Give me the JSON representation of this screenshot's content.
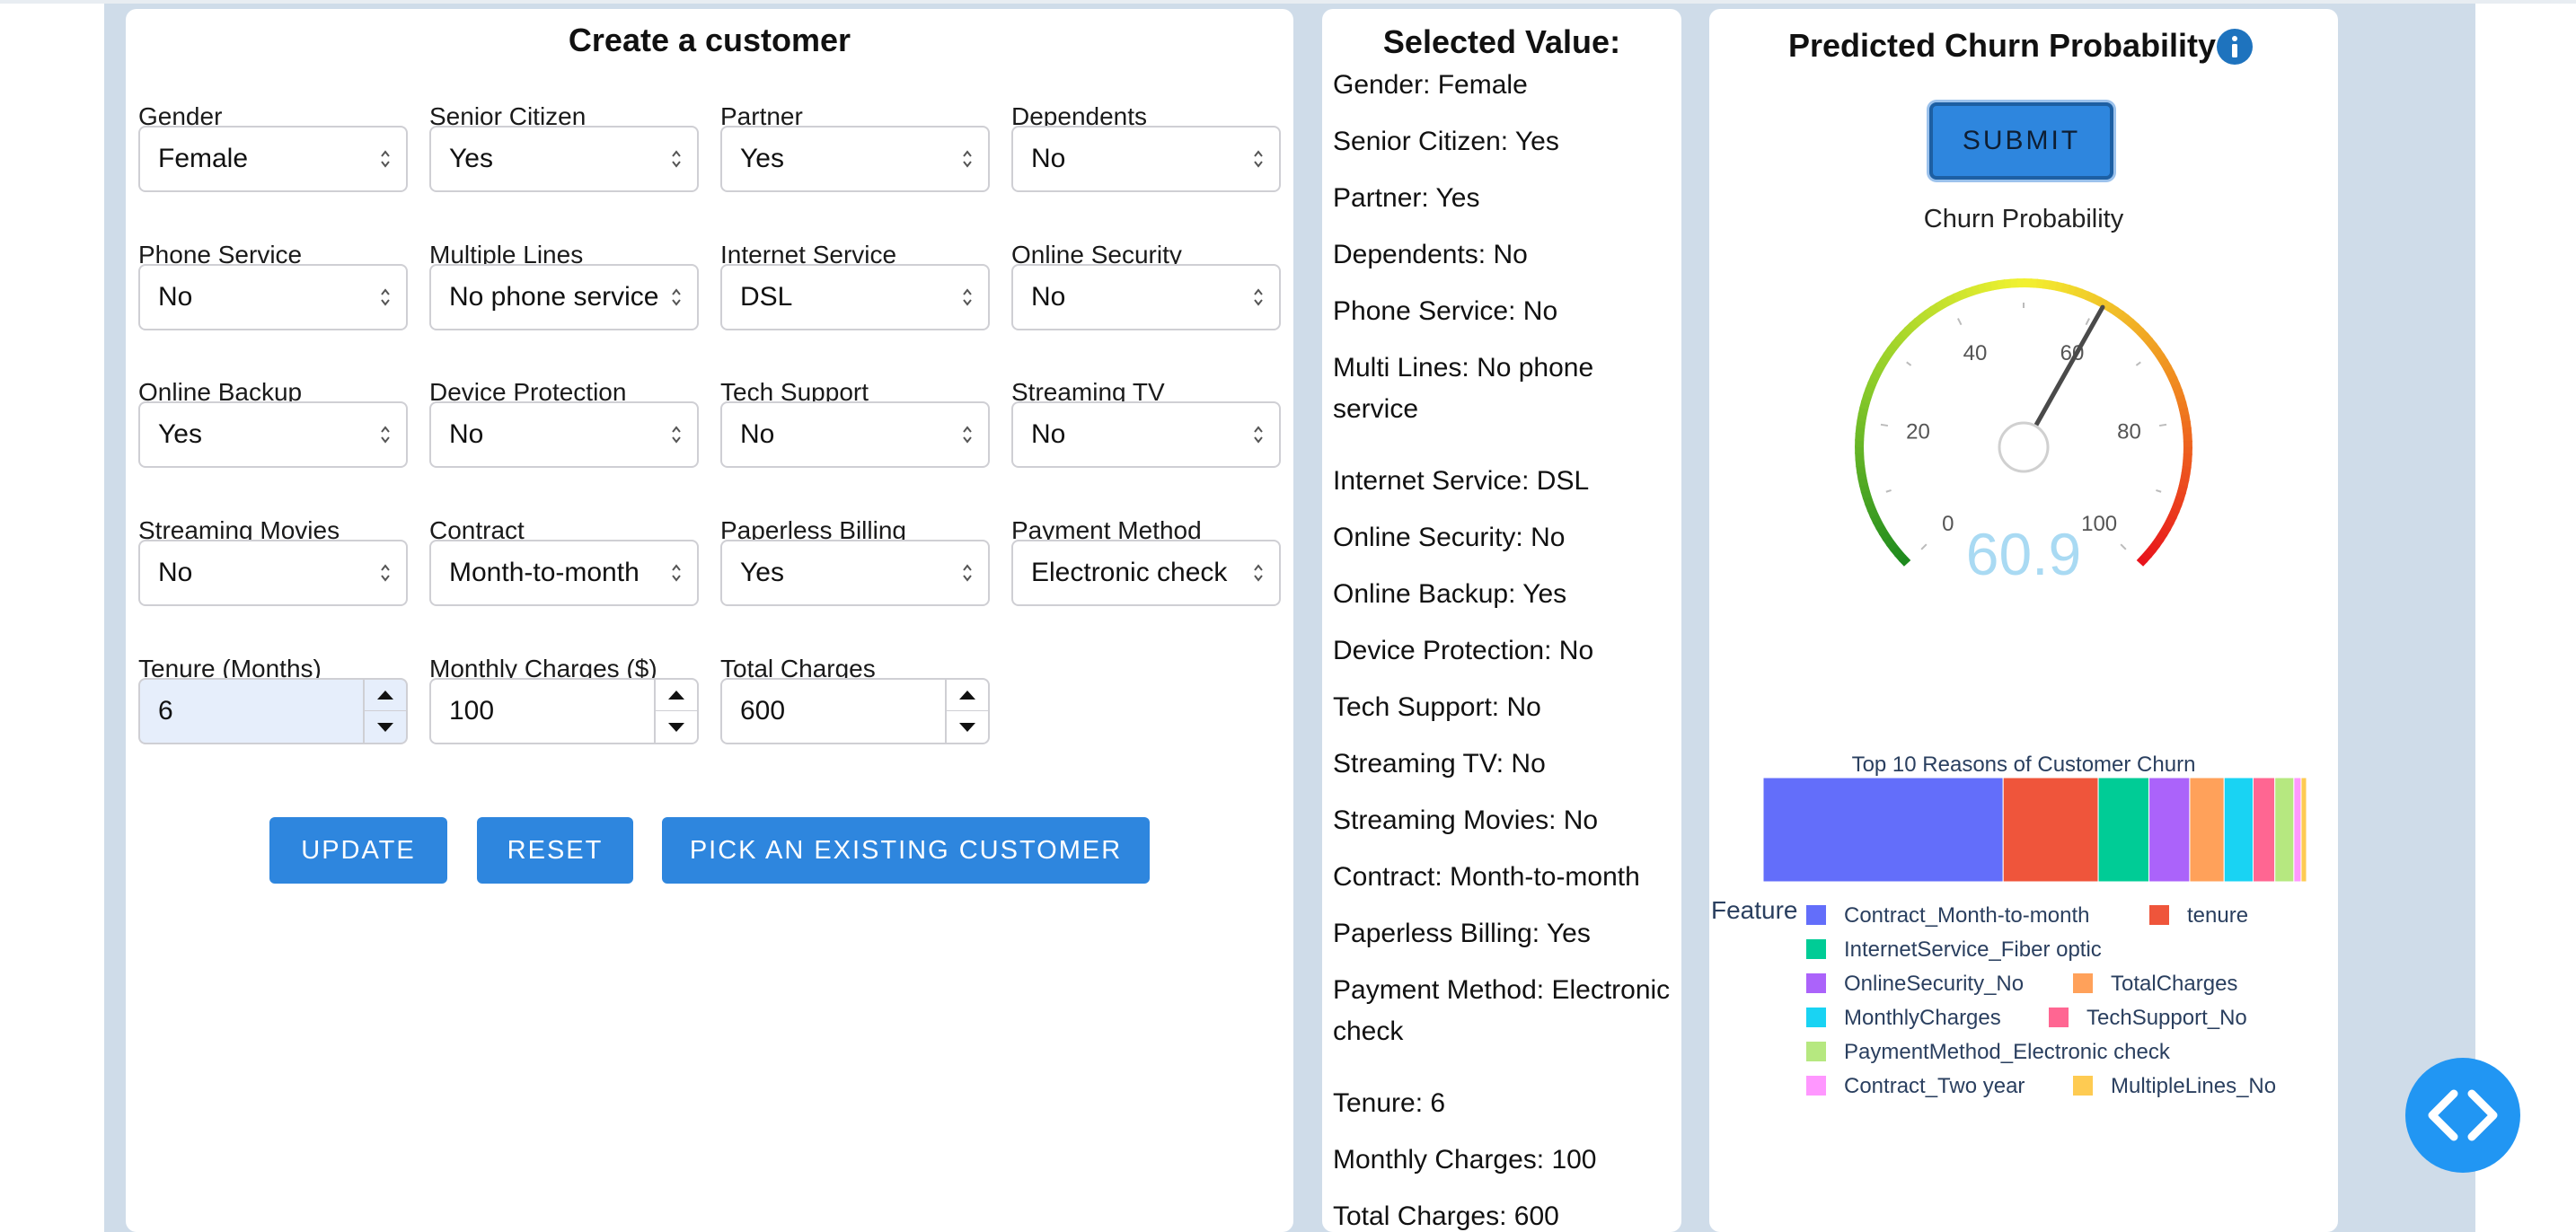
{
  "create": {
    "title": "Create a customer",
    "fields": [
      {
        "label": "Gender",
        "value": "Female"
      },
      {
        "label": "Senior Citizen",
        "value": "Yes"
      },
      {
        "label": "Partner",
        "value": "Yes"
      },
      {
        "label": "Dependents",
        "value": "No"
      },
      {
        "label": "Phone Service",
        "value": "No"
      },
      {
        "label": "Multiple Lines",
        "value": "No phone service"
      },
      {
        "label": "Internet Service",
        "value": "DSL"
      },
      {
        "label": "Online Security",
        "value": "No"
      },
      {
        "label": "Online Backup",
        "value": "Yes"
      },
      {
        "label": "Device Protection",
        "value": "No"
      },
      {
        "label": "Tech Support",
        "value": "No"
      },
      {
        "label": "Streaming TV",
        "value": "No"
      },
      {
        "label": "Streaming Movies",
        "value": "No"
      },
      {
        "label": "Contract",
        "value": "Month-to-month"
      },
      {
        "label": "Paperless Billing",
        "value": "Yes"
      },
      {
        "label": "Payment Method",
        "value": "Electronic check"
      }
    ],
    "numbers": [
      {
        "label": "Tenure (Months)",
        "value": "6"
      },
      {
        "label": "Monthly Charges ($)",
        "value": "100"
      },
      {
        "label": "Total Charges",
        "value": "600"
      }
    ],
    "buttons": {
      "update": "Update",
      "reset": "Reset",
      "pick": "Pick an existing customer"
    }
  },
  "selected": {
    "title": "Selected Value:",
    "lines": [
      "Gender: Female",
      "Senior Citizen: Yes",
      "Partner: Yes",
      "Dependents: No",
      "Phone Service: No",
      "Multi Lines: No phone service",
      "Internet Service: DSL",
      "Online Security: No",
      "Online Backup: Yes",
      "Device Protection: No",
      "Tech Support: No",
      "Streaming TV: No",
      "Streaming Movies: No",
      "Contract: Month-to-month",
      "Paperless Billing: Yes",
      "Payment Method: Electronic check",
      "Tenure: 6",
      "Monthly Charges: 100",
      "Total Charges: 600"
    ]
  },
  "predict": {
    "title": "Predicted Churn Probability",
    "info_icon": "info-icon",
    "submit_label": "SUBMIT",
    "gauge_title": "Churn Probability",
    "gauge_value": 60.9,
    "gauge_value_text": "60.9",
    "gauge_min": 0,
    "gauge_max": 100,
    "gauge_ticks": [
      "0",
      "20",
      "40",
      "60",
      "80",
      "100"
    ],
    "bar_title": "Top 10 Reasons of Customer Churn",
    "legend_title": "Feature"
  },
  "chart_data": [
    {
      "type": "gauge",
      "title": "Churn Probability",
      "value": 60.9,
      "range": [
        0,
        100
      ],
      "ticks": [
        0,
        20,
        40,
        60,
        80,
        100
      ],
      "colors": [
        "#1e8a1e",
        "#8ccc2a",
        "#f2f230",
        "#f08a20",
        "#e8141c"
      ]
    },
    {
      "type": "bar",
      "orientation": "horizontal-stacked",
      "title": "Top 10 Reasons of Customer Churn",
      "legend_title": "Feature",
      "series": [
        {
          "name": "Contract_Month-to-month",
          "value": 0.265,
          "color": "#636efa"
        },
        {
          "name": "tenure",
          "value": 0.105,
          "color": "#ef553b"
        },
        {
          "name": "InternetService_Fiber optic",
          "value": 0.056,
          "color": "#00cc96"
        },
        {
          "name": "OnlineSecurity_No",
          "value": 0.045,
          "color": "#ab63fa"
        },
        {
          "name": "TotalCharges",
          "value": 0.038,
          "color": "#ffa15a"
        },
        {
          "name": "MonthlyCharges",
          "value": 0.032,
          "color": "#19d3f3"
        },
        {
          "name": "TechSupport_No",
          "value": 0.024,
          "color": "#ff6692"
        },
        {
          "name": "PaymentMethod_Electronic check",
          "value": 0.021,
          "color": "#b6e880"
        },
        {
          "name": "Contract_Two year",
          "value": 0.008,
          "color": "#ff97ff"
        },
        {
          "name": "MultipleLines_No",
          "value": 0.006,
          "color": "#fecb52"
        }
      ],
      "legend_placement": "bottom"
    }
  ],
  "fab": {
    "icon": "code-icon"
  }
}
